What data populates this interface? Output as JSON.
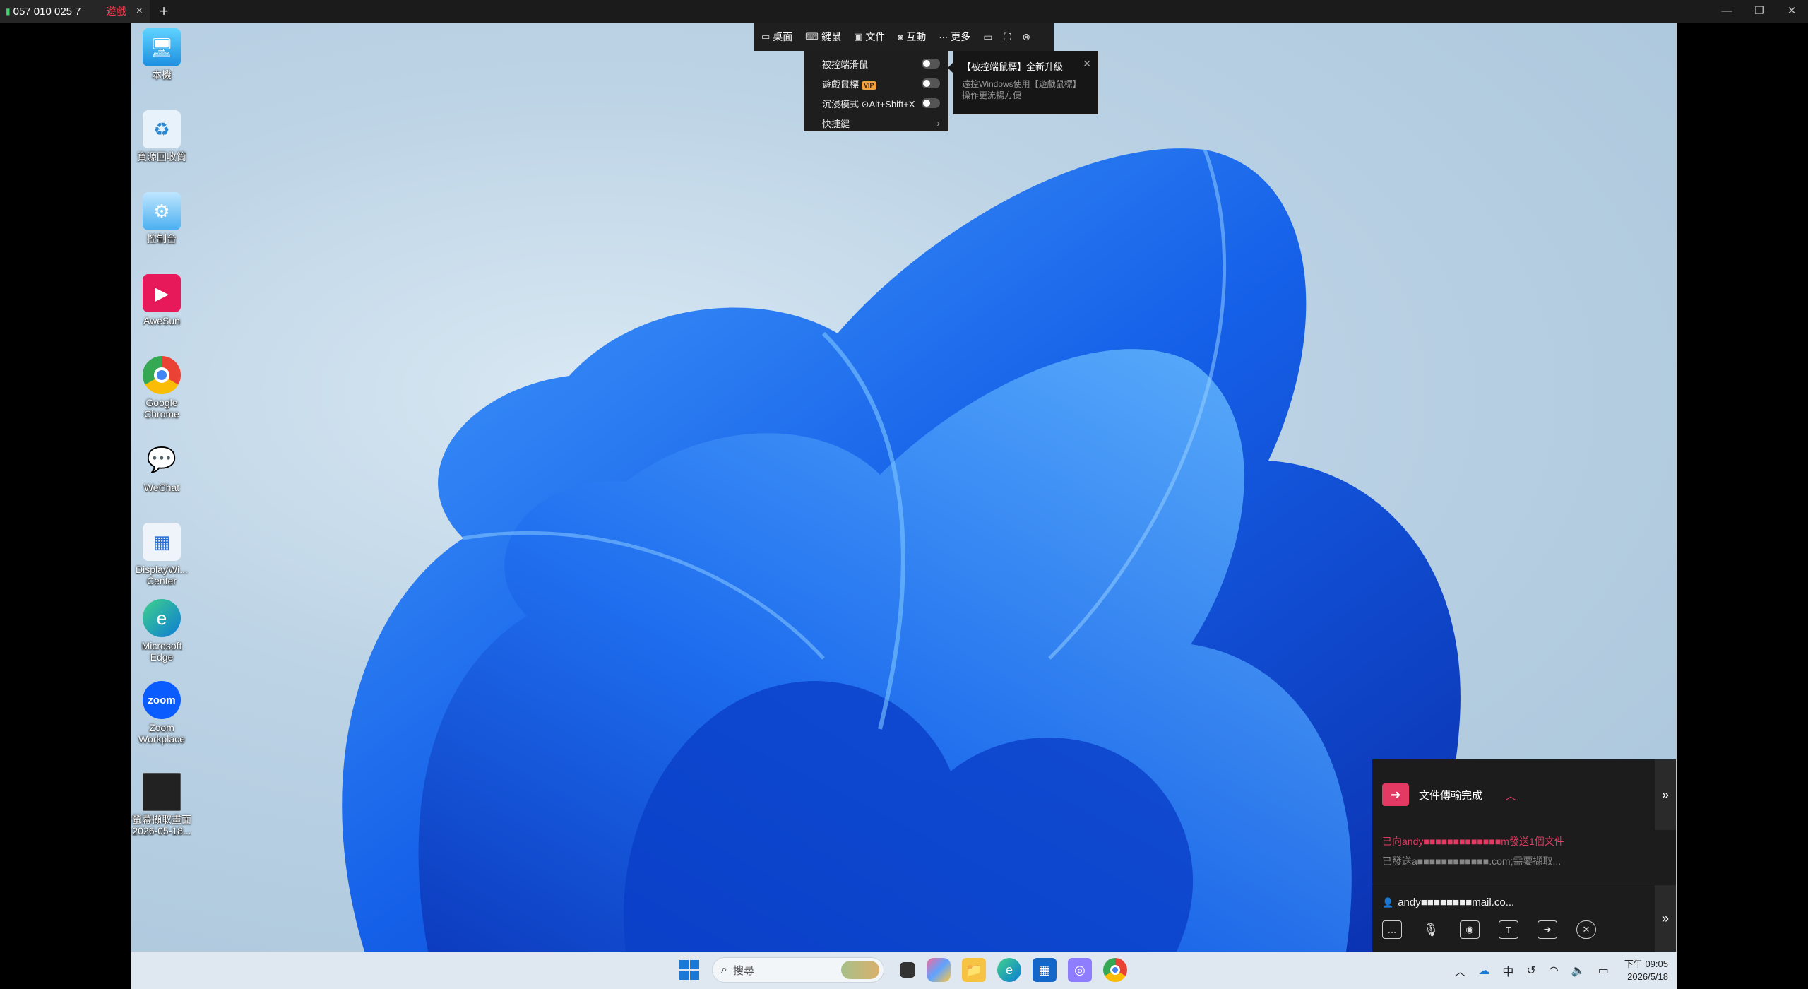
{
  "window": {
    "tab_id": "057 010 025 7",
    "tab_tag": "遊戲",
    "close_glyph": "×",
    "new_tab_glyph": "+",
    "controls": [
      "—",
      "❐",
      "✕"
    ]
  },
  "remote_toolbar": {
    "items": [
      {
        "label": "桌面",
        "icon": "monitor-icon"
      },
      {
        "label": "鍵鼠",
        "icon": "keyboard-icon"
      },
      {
        "label": "文件",
        "icon": "folder-icon"
      },
      {
        "label": "互動",
        "icon": "camera-icon"
      },
      {
        "label": "更多",
        "icon": "more-icon"
      }
    ]
  },
  "menu": {
    "items": [
      {
        "label": "被控端滑鼠",
        "control": "toggle"
      },
      {
        "label": "遊戲鼠標",
        "badge": "VIP",
        "control": "toggle"
      },
      {
        "label": "沉浸模式 ⊙Alt+Shift+X",
        "control": "toggle"
      },
      {
        "label": "快捷鍵",
        "control": "chevron"
      }
    ]
  },
  "tooltip": {
    "title": "【被控端鼠標】全新升級",
    "line1": "遠控Windows使用【遊戲鼠標】",
    "line2": "操作更流暢方便"
  },
  "desktop_icons": [
    {
      "label": "本機"
    },
    {
      "label": "資源回收筒"
    },
    {
      "label": "控制台"
    },
    {
      "label": "AweSun"
    },
    {
      "label": "Google Chrome"
    },
    {
      "label": "WeChat"
    },
    {
      "label": "DisplayWi... Center"
    },
    {
      "label": "Microsoft Edge"
    },
    {
      "label": "Zoom Workplace"
    },
    {
      "label": "螢幕擷取畫面 2026-05-18..."
    }
  ],
  "file_panel": {
    "title": "文件傳輸完成",
    "msg1": "已向andy■■■■■■■■■■■■■m發送1個文件",
    "msg2": "已發送a■■■■■■■■■■■■.com;需要擷取...",
    "user": "andy■■■■■■■■mail.co...",
    "expand_glyph": "»"
  },
  "taskbar": {
    "search_placeholder": "搜尋",
    "time": "下午 09:05",
    "date": "2026/5/18",
    "ime": "中"
  }
}
